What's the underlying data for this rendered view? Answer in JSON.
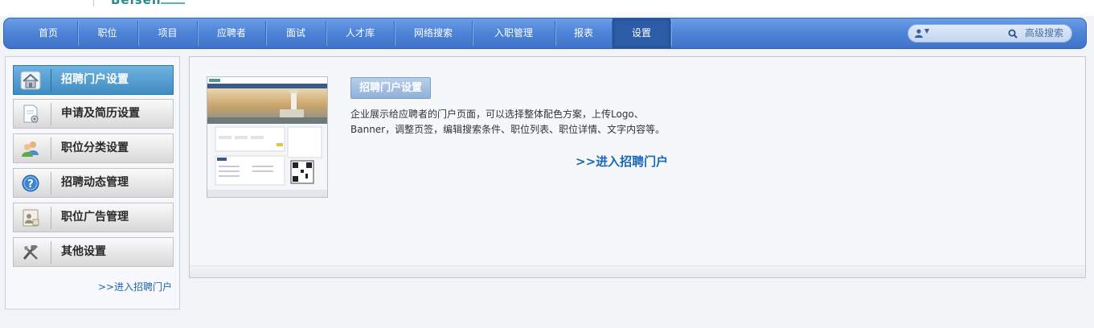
{
  "header": {
    "logo_text": "Beisen"
  },
  "nav": {
    "items": [
      {
        "label": "首页"
      },
      {
        "label": "职位"
      },
      {
        "label": "项目"
      },
      {
        "label": "应聘者"
      },
      {
        "label": "面试"
      },
      {
        "label": "人才库"
      },
      {
        "label": "网络搜索"
      },
      {
        "label": "入职管理"
      },
      {
        "label": "报表"
      },
      {
        "label": "设置"
      }
    ],
    "active_index": 9,
    "search": {
      "placeholder": "",
      "advanced_label": "高级搜索"
    }
  },
  "sidebar": {
    "items": [
      {
        "label": "招聘门户设置",
        "icon": "home-icon"
      },
      {
        "label": "申请及简历设置",
        "icon": "document-gear-icon"
      },
      {
        "label": "职位分类设置",
        "icon": "users-icon"
      },
      {
        "label": "招聘动态管理",
        "icon": "help-icon"
      },
      {
        "label": "职位广告管理",
        "icon": "id-card-icon"
      },
      {
        "label": "其他设置",
        "icon": "tools-icon"
      }
    ],
    "active_index": 0,
    "enter_link": ">>进入招聘门户"
  },
  "main": {
    "title": "招聘门户设置",
    "description_line1": "企业展示给应聘者的门户页面，可以选择整体配色方案，上传Logo、",
    "description_line2": "Banner，调整页签，编辑搜索条件、职位列表、职位详情、文字内容等。",
    "enter_link": ">>进入招聘门户"
  },
  "colors": {
    "nav_bg": "#4f85d8",
    "nav_active": "#2e5da8",
    "side_active": "#3f8cc3",
    "link": "#1868b7"
  }
}
